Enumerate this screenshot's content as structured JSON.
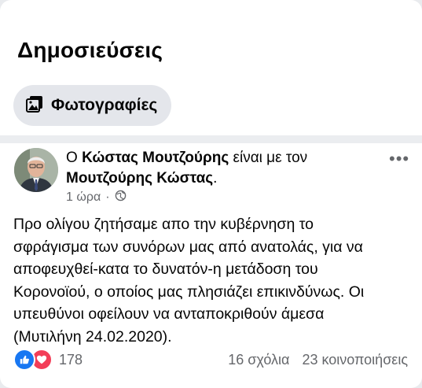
{
  "section": {
    "title": "Δημοσιεύσεις"
  },
  "filter": {
    "label": "Φωτογραφίες",
    "icon": "photos-icon"
  },
  "post": {
    "author_prefix": "Ο",
    "author": "Κώστας Μουτζούρης",
    "with_text": "είναι με τον",
    "tagged": "Μουτζούρης Κώστας",
    "tagged_suffix": ".",
    "time": "1 ώρα",
    "separator": "·",
    "privacy_icon": "globe-icon",
    "body_lines": [
      "Προ ολίγου ζητήσαμε απο την κυβέρνηση το",
      "σφράγισμα των συνόρων μας από ανατολάς, για να",
      "αποφευχθεί-κατα το δυνατόν-η μετάδοση του",
      "Κορονοϊού, ο οποίος μας πλησιάζει επικινδύνως. Οι",
      "υπευθύνοι οφείλουν να ανταποκριθούν  άμεσα",
      "(Μυτιλήνη 24.02.2020)."
    ],
    "reaction_count": "178",
    "comments": "16 σχόλια",
    "shares": "23 κοινοποιήσεις"
  },
  "colors": {
    "like": "#1877f2",
    "love": "#f33e58",
    "secondary_text": "#65676b"
  }
}
